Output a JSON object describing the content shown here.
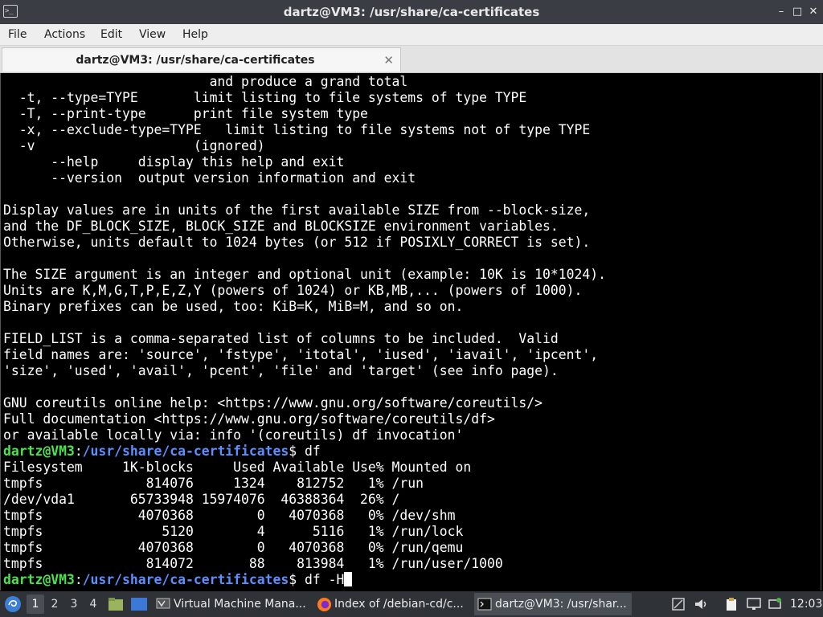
{
  "window": {
    "title": "dartz@VM3: /usr/share/ca-certificates",
    "controls": {
      "minimize": "–",
      "maximize": "□",
      "close": "✕"
    }
  },
  "menu": [
    "File",
    "Actions",
    "Edit",
    "View",
    "Help"
  ],
  "tab": {
    "label": "dartz@VM3: /usr/share/ca-certificates",
    "close": "✕"
  },
  "terminal": {
    "lines": [
      "                          and produce a grand total",
      "  -t, --type=TYPE       limit listing to file systems of type TYPE",
      "  -T, --print-type      print file system type",
      "  -x, --exclude-type=TYPE   limit listing to file systems not of type TYPE",
      "  -v                    (ignored)",
      "      --help     display this help and exit",
      "      --version  output version information and exit",
      "",
      "Display values are in units of the first available SIZE from --block-size,",
      "and the DF_BLOCK_SIZE, BLOCK_SIZE and BLOCKSIZE environment variables.",
      "Otherwise, units default to 1024 bytes (or 512 if POSIXLY_CORRECT is set).",
      "",
      "The SIZE argument is an integer and optional unit (example: 10K is 10*1024).",
      "Units are K,M,G,T,P,E,Z,Y (powers of 1024) or KB,MB,... (powers of 1000).",
      "Binary prefixes can be used, too: KiB=K, MiB=M, and so on.",
      "",
      "FIELD_LIST is a comma-separated list of columns to be included.  Valid",
      "field names are: 'source', 'fstype', 'itotal', 'iused', 'iavail', 'ipcent',",
      "'size', 'used', 'avail', 'pcent', 'file' and 'target' (see info page).",
      "",
      "GNU coreutils online help: <https://www.gnu.org/software/coreutils/>",
      "Full documentation <https://www.gnu.org/software/coreutils/df>",
      "or available locally via: info '(coreutils) df invocation'"
    ],
    "prompt1": {
      "user": "dartz@VM3",
      "sep": ":",
      "path": "/usr/share/ca-certificates",
      "symbol": "$ ",
      "command": "df"
    },
    "df_header": "Filesystem     1K-blocks     Used Available Use% Mounted on",
    "df_rows": [
      "tmpfs             814076     1324    812752   1% /run",
      "/dev/vda1       65733948 15974076  46388364  26% /",
      "tmpfs            4070368        0   4070368   0% /dev/shm",
      "tmpfs               5120        4      5116   1% /run/lock",
      "tmpfs            4070368        0   4070368   0% /run/qemu",
      "tmpfs             814072       88    813984   1% /run/user/1000"
    ],
    "prompt2": {
      "user": "dartz@VM3",
      "sep": ":",
      "path": "/usr/share/ca-certificates",
      "symbol": "$ ",
      "command": "df -H"
    }
  },
  "taskbar": {
    "workspaces": [
      "1",
      "2",
      "3",
      "4"
    ],
    "tasks": [
      {
        "label": "Virtual Machine Mana...",
        "icon": "virt-manager-icon"
      },
      {
        "label": "Index of /debian-cd/c...",
        "icon": "firefox-icon"
      },
      {
        "label": "dartz@VM3: /usr/shar...",
        "icon": "terminal-icon"
      }
    ],
    "clock": "12:03",
    "colors": {
      "accent": "#4a4f56",
      "prompt_user": "#4ee44e",
      "prompt_path": "#5c8fff"
    }
  }
}
